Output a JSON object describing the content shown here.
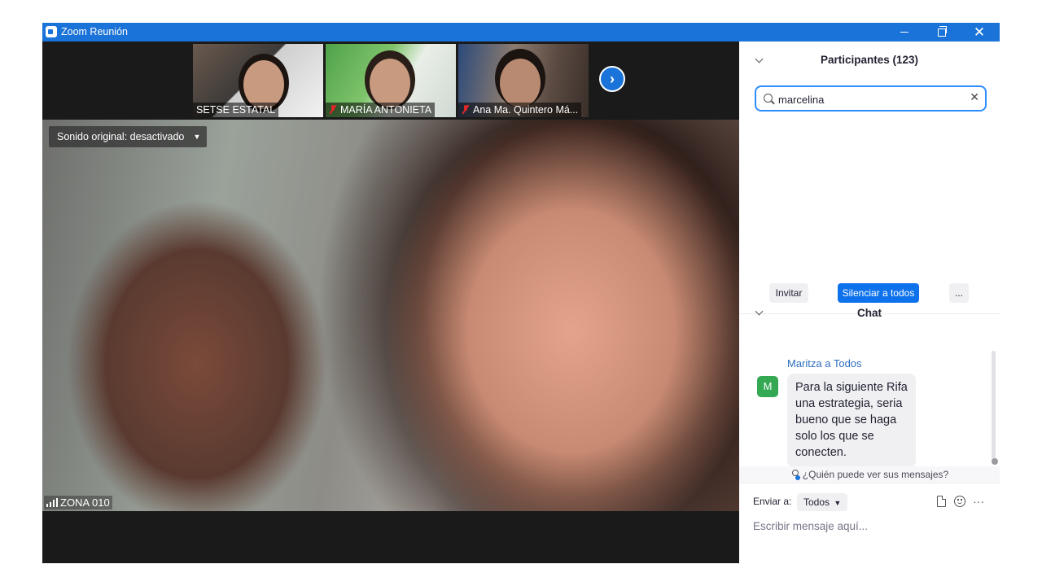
{
  "window": {
    "title": "Zoom Reunión",
    "controls": [
      "minimize",
      "restore",
      "close"
    ]
  },
  "gallery": {
    "thumbnails": [
      {
        "name": "SETSE ESTATAL",
        "muted": false
      },
      {
        "name": "MARÍA ANTONIETA",
        "muted": true
      },
      {
        "name": "Ana Ma. Quintero Má...",
        "muted": true
      }
    ],
    "next_icon": "chevron-right-icon"
  },
  "main_video": {
    "sound_chip": "Sonido original: desactivado",
    "speaker_name": "ZONA 010"
  },
  "participants": {
    "title": "Participantes (123)",
    "search_value": "marcelina",
    "invite_label": "Invitar",
    "mute_all_label": "Silenciar a todos",
    "more_label": "..."
  },
  "chat": {
    "title": "Chat",
    "messages": [
      {
        "sender": "Maritza a Todos",
        "avatar_letter": "M",
        "text": "Para la siguiente Rifa una estrategia, seria bueno que se haga solo los que se conecten."
      }
    ],
    "who_can_see": "¿Quién puede ver sus mensajes?",
    "send_to_label": "Enviar a:",
    "send_to_value": "Todos",
    "input_placeholder": "Escribir mensaje aquí...",
    "more_options": "···"
  },
  "colors": {
    "titlebar": "#1a73d8",
    "primary_button": "#0e72ed",
    "search_border": "#2d8cff",
    "avatar_bg": "#34a853",
    "muted_mic": "#e02828"
  }
}
